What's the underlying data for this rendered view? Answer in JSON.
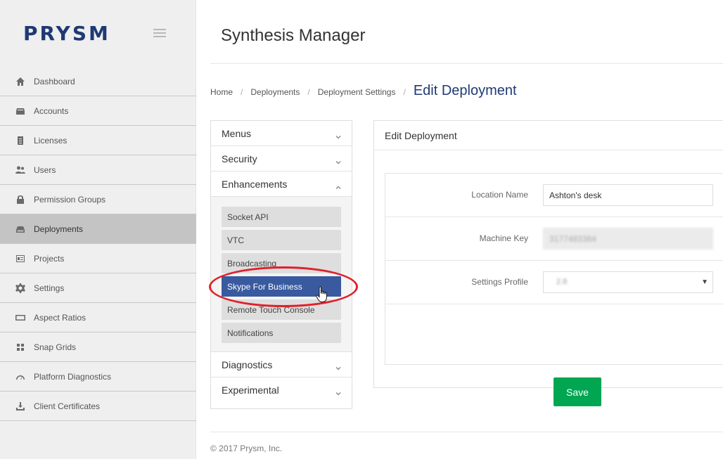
{
  "brand": {
    "logo": "PRYSM",
    "accent": "#1f3a73"
  },
  "sidebar": {
    "items": [
      {
        "label": "Dashboard",
        "icon": "home-icon"
      },
      {
        "label": "Accounts",
        "icon": "inbox-icon"
      },
      {
        "label": "Licenses",
        "icon": "document-icon"
      },
      {
        "label": "Users",
        "icon": "users-icon"
      },
      {
        "label": "Permission Groups",
        "icon": "lock-icon"
      },
      {
        "label": "Deployments",
        "icon": "drive-icon",
        "active": true
      },
      {
        "label": "Projects",
        "icon": "id-card-icon"
      },
      {
        "label": "Settings",
        "icon": "gear-icon"
      },
      {
        "label": "Aspect Ratios",
        "icon": "rectangle-icon"
      },
      {
        "label": "Snap Grids",
        "icon": "grid-icon"
      },
      {
        "label": "Platform Diagnostics",
        "icon": "gauge-icon"
      },
      {
        "label": "Client Certificates",
        "icon": "download-icon"
      }
    ]
  },
  "header": {
    "title": "Synthesis Manager"
  },
  "breadcrumb": {
    "items": [
      "Home",
      "Deployments",
      "Deployment Settings"
    ],
    "separator": "/",
    "current": "Edit Deployment"
  },
  "menu": {
    "sections": [
      {
        "label": "Menus",
        "expanded": false
      },
      {
        "label": "Security",
        "expanded": false
      },
      {
        "label": "Enhancements",
        "expanded": true
      },
      {
        "label": "Diagnostics",
        "expanded": false
      },
      {
        "label": "Experimental",
        "expanded": false
      }
    ],
    "enhancements": [
      "Socket API",
      "VTC",
      "Broadcasting",
      "Skype For Business",
      "Remote Touch Console",
      "Notifications"
    ],
    "selected": "Skype For Business"
  },
  "edit": {
    "title": "Edit Deployment",
    "location_label": "Location Name",
    "location_value": "Ashton's desk",
    "machine_label": "Machine Key",
    "machine_value": "3177483384",
    "profile_label": "Settings Profile",
    "profile_value": "2.8",
    "save_label": "Save",
    "save_color": "#00a651"
  },
  "footer": {
    "copyright": "© 2017 Prysm, Inc."
  }
}
